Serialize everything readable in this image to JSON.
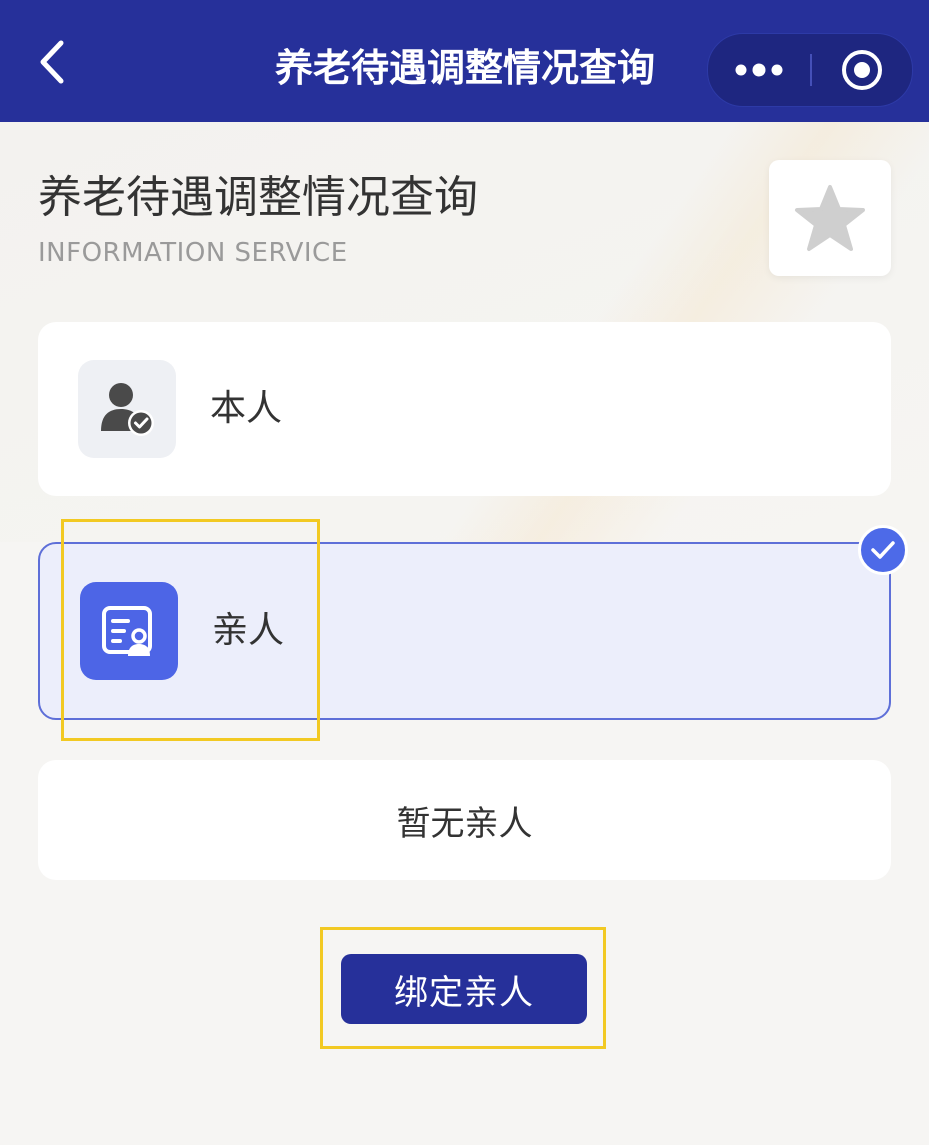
{
  "nav": {
    "title": "养老待遇调整情况查询",
    "back_icon": "chevron-left-icon",
    "more_icon": "more-dots-icon",
    "close_icon": "target-circle-icon"
  },
  "header": {
    "title": "养老待遇调整情况查询",
    "subtitle": "INFORMATION SERVICE",
    "favorite_icon": "star-icon"
  },
  "options": [
    {
      "label": "本人",
      "icon": "person-check-icon",
      "selected": false
    },
    {
      "label": "亲人",
      "icon": "id-card-person-icon",
      "selected": true
    }
  ],
  "empty_state": {
    "text": "暂无亲人"
  },
  "bind_button": {
    "label": "绑定亲人"
  },
  "colors": {
    "nav_bg": "#26309a",
    "accent": "#4d65e6",
    "selected_bg": "#eceefb",
    "highlight": "#f2c922"
  }
}
